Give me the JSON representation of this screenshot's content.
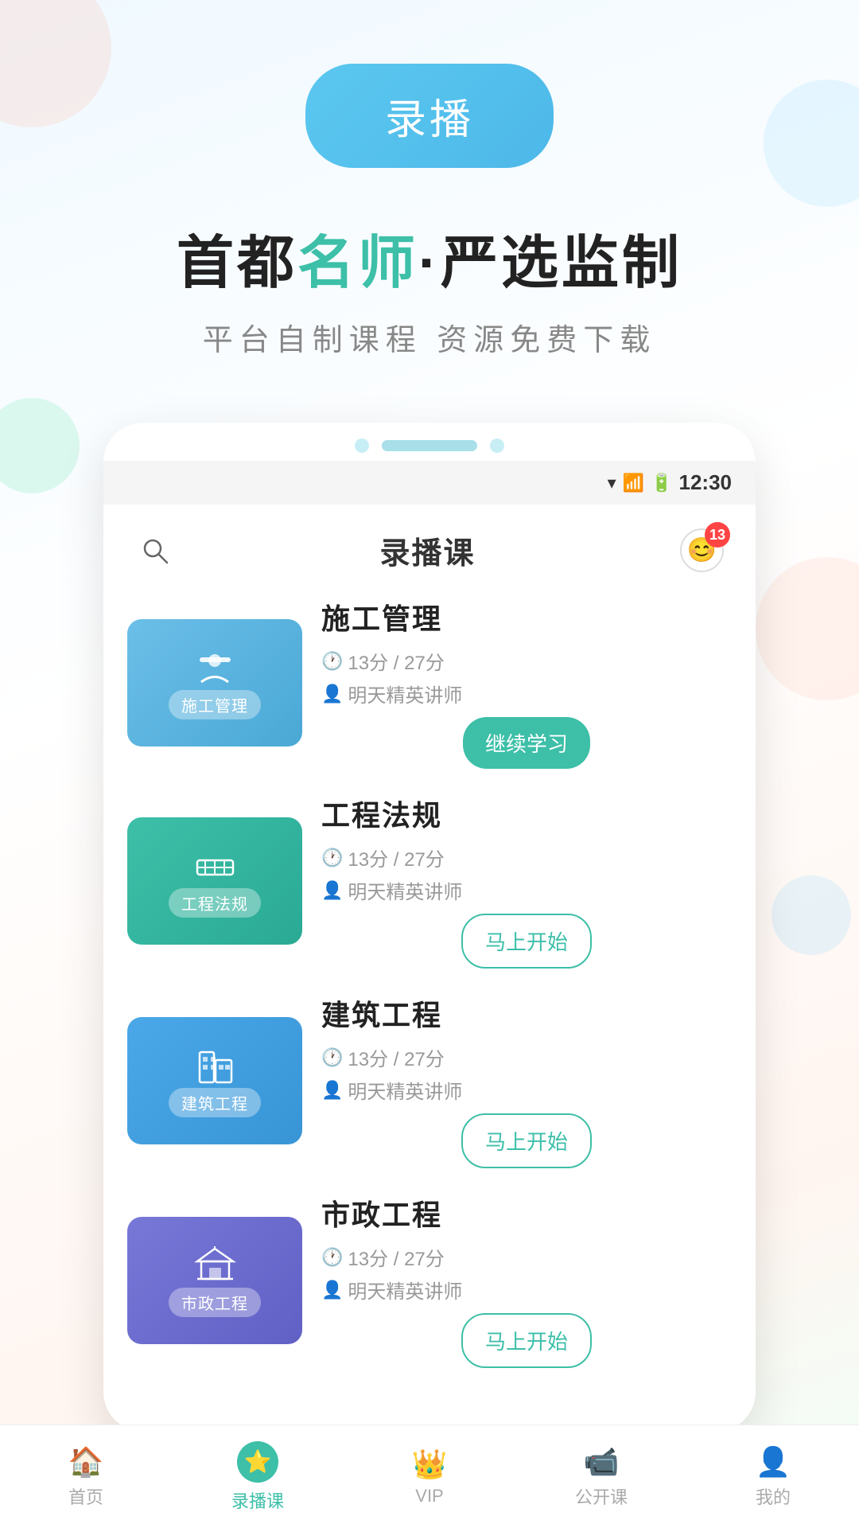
{
  "hero": {
    "btn_label": "录播",
    "title_part1": "首都",
    "title_highlight": "名师",
    "title_middle": "·",
    "title_part2": "严选监制",
    "subtitle": "平台自制课程  资源免费下载"
  },
  "phone": {
    "status": {
      "time": "12:30"
    },
    "header": {
      "title": "录播课",
      "badge": "13"
    }
  },
  "courses": [
    {
      "id": 1,
      "name": "施工管理",
      "thumb_label": "施工管理",
      "thumb_class": "thumb-1",
      "thumb_icon": "👷",
      "duration": "13分 / 27分",
      "teacher": "明天精英讲师",
      "btn_label": "继续学习",
      "btn_type": "continue"
    },
    {
      "id": 2,
      "name": "工程法规",
      "thumb_label": "工程法规",
      "thumb_class": "thumb-2",
      "thumb_icon": "🚧",
      "duration": "13分 / 27分",
      "teacher": "明天精英讲师",
      "btn_label": "马上开始",
      "btn_type": "start"
    },
    {
      "id": 3,
      "name": "建筑工程",
      "thumb_label": "建筑工程",
      "thumb_class": "thumb-3",
      "thumb_icon": "🏢",
      "duration": "13分 / 27分",
      "teacher": "明天精英讲师",
      "btn_label": "马上开始",
      "btn_type": "start"
    },
    {
      "id": 4,
      "name": "市政工程",
      "thumb_label": "市政工程",
      "thumb_class": "thumb-4",
      "thumb_icon": "🏛",
      "duration": "13分 / 27分",
      "teacher": "明天精英讲师",
      "btn_label": "马上开始",
      "btn_type": "start"
    }
  ],
  "nav": {
    "items": [
      {
        "id": "home",
        "label": "首页",
        "icon": "🏠",
        "active": false
      },
      {
        "id": "record",
        "label": "录播课",
        "icon": "⭐",
        "active": true
      },
      {
        "id": "vip",
        "label": "VIP",
        "icon": "👑",
        "active": false
      },
      {
        "id": "opencourse",
        "label": "公开课",
        "icon": "📹",
        "active": false
      },
      {
        "id": "mine",
        "label": "我的",
        "icon": "👤",
        "active": false
      }
    ]
  }
}
